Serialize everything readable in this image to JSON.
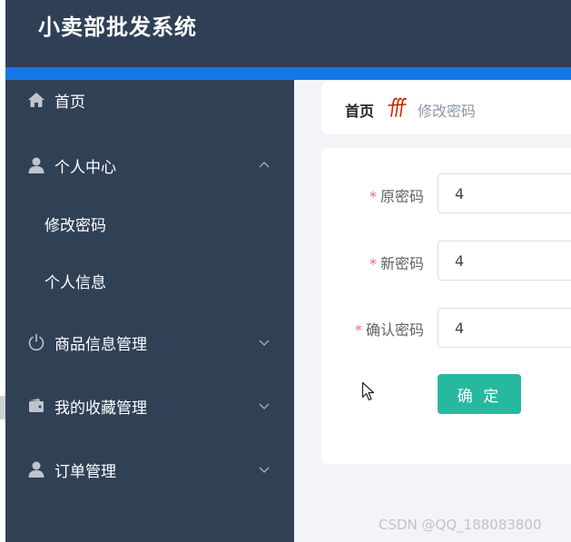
{
  "header": {
    "title": "小卖部批发系统"
  },
  "sidebar": {
    "items": [
      {
        "label": "首页",
        "icon": "home-icon"
      },
      {
        "label": "个人中心",
        "icon": "user-icon",
        "expanded": true,
        "children": [
          {
            "label": "修改密码"
          },
          {
            "label": "个人信息"
          }
        ]
      },
      {
        "label": "商品信息管理",
        "icon": "power-icon"
      },
      {
        "label": "我的收藏管理",
        "icon": "wallet-icon"
      },
      {
        "label": "订单管理",
        "icon": "user-icon"
      }
    ]
  },
  "breadcrumb": {
    "home": "首页",
    "separator_icon": "fff-icon",
    "current": "修改密码"
  },
  "form": {
    "required_mark": "*",
    "fields": [
      {
        "label": "原密码",
        "value": "4"
      },
      {
        "label": "新密码",
        "value": "4"
      },
      {
        "label": "确认密码",
        "value": "4"
      }
    ],
    "submit_label": "确 定"
  },
  "watermark": "CSDN @QQ_188083800",
  "colors": {
    "header_bg": "#2f4056",
    "accent_bar": "#1677e6",
    "sidebar_bg": "#304156",
    "submit_bg": "#26b9a0",
    "required": "#f56c6c",
    "separator": "#cc2200"
  }
}
